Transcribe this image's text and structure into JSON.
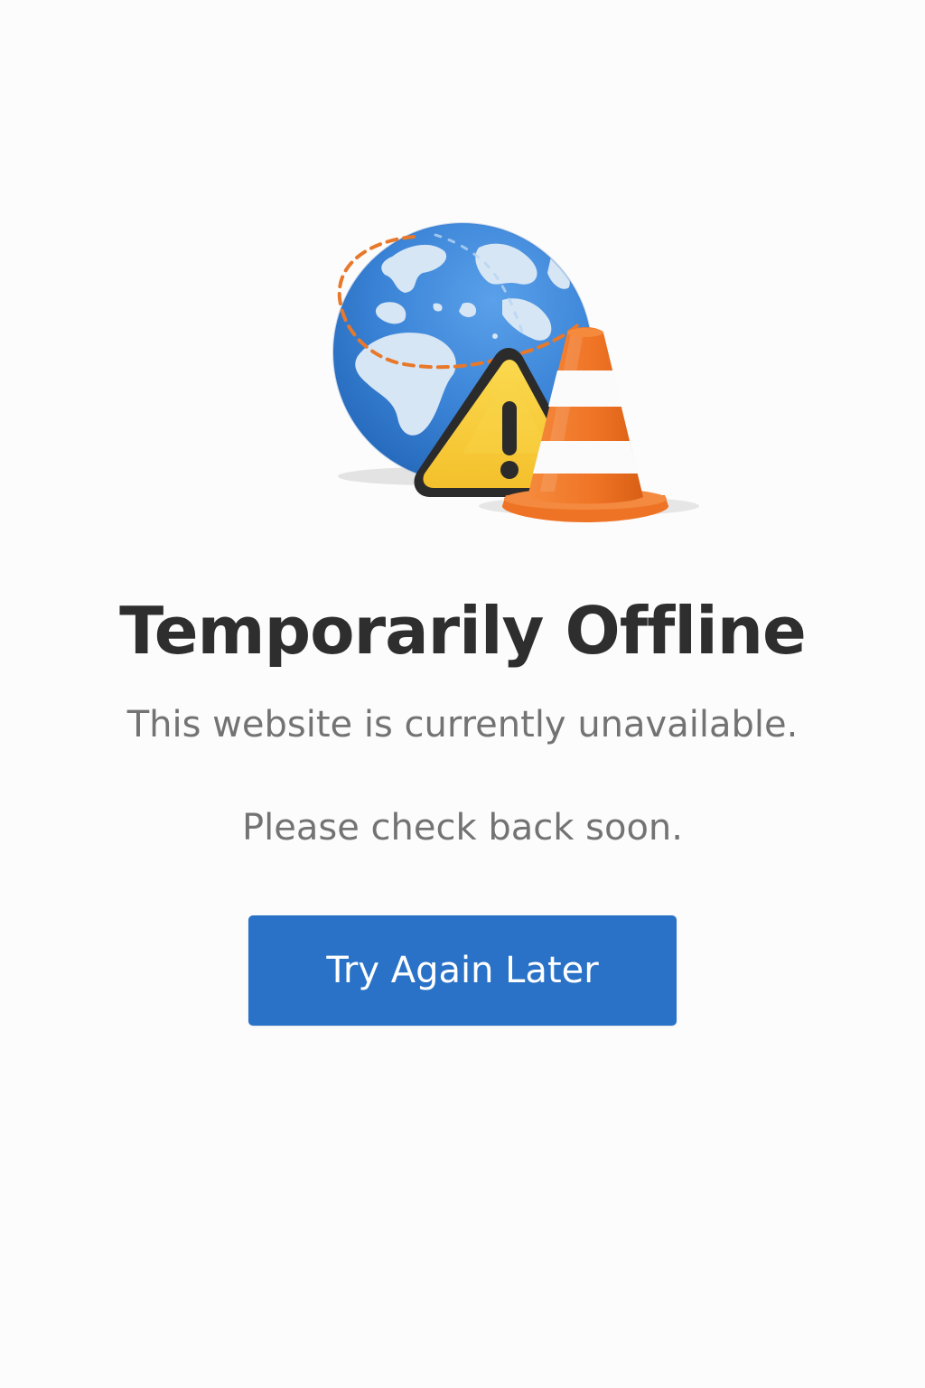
{
  "page": {
    "background": "#fcfcfc"
  },
  "illustration": {
    "icons": [
      "globe-icon",
      "warning-triangle-icon",
      "traffic-cone-icon"
    ]
  },
  "title": "Temporarily Offline",
  "message": {
    "line1": "This website is currently unavailable.",
    "line2": "Please check back soon."
  },
  "button": {
    "label": "Try Again Later",
    "color": "#2a72c7"
  },
  "colors": {
    "globe_ocean": "#3a83d6",
    "globe_land": "#d6e6f5",
    "dashed_path": "#e8782a",
    "warning_fill": "#f7cf3e",
    "cone_orange": "#ef7325",
    "text_title": "#2e2e2e",
    "text_body": "#737373"
  }
}
